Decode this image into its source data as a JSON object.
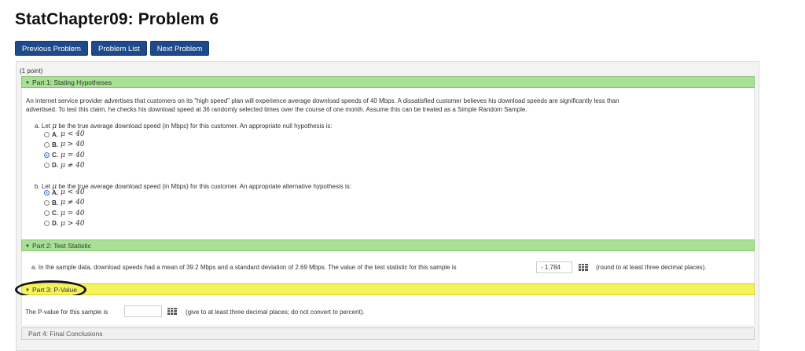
{
  "page_title": "StatChapter09: Problem 6",
  "nav": {
    "previous": "Previous Problem",
    "list": "Problem List",
    "next": "Next Problem"
  },
  "points": "(1 point)",
  "part1": {
    "header": "Part 1: Stating Hypotheses",
    "intro_line1": "An internet service provider advertises that customers on its \"high speed\" plan will experience average download speeds of 40 Mbps. A dissatisfied customer believes his download speeds are significantly less than",
    "intro_line2": "advertised. To test this claim, he checks his download speed at 36 randomly selected times over the course of one month. Assume this can be treated as a Simple Random Sample.",
    "qa": {
      "prompt_start": "a. Let",
      "symbol": "μ",
      "prompt_rest": "be the true average download speed (in Mbps) for this customer. An appropriate null hypothesis is:",
      "options": [
        {
          "label": "A.",
          "expr": "μ < 40",
          "selected": false
        },
        {
          "label": "B.",
          "expr": "μ > 40",
          "selected": false
        },
        {
          "label": "C.",
          "expr": "μ = 40",
          "selected": true
        },
        {
          "label": "D.",
          "expr": "μ ≠ 40",
          "selected": false
        }
      ]
    },
    "qb": {
      "prompt_start": "b. Let",
      "symbol": "μ",
      "prompt_rest": "be the true average download speed (in Mbps) for this customer. An appropriate alternative hypothesis is:",
      "options": [
        {
          "label": "A.",
          "expr": "μ < 40",
          "selected": true
        },
        {
          "label": "B.",
          "expr": "μ ≠ 40",
          "selected": false
        },
        {
          "label": "C.",
          "expr": "μ = 40",
          "selected": false
        },
        {
          "label": "D.",
          "expr": "μ > 40",
          "selected": false
        }
      ]
    }
  },
  "part2": {
    "header": "Part 2: Test Statistic",
    "question": "a. In the sample data, download speeds had a mean of 39.2 Mbps and a standard deviation of 2.69 Mbps. The value of the test statistic for this sample is",
    "answer": "- 1.784",
    "hint": "(round to at least three decimal places)."
  },
  "part3": {
    "header": "Part 3: P-Value",
    "question": "The P-value for this sample is",
    "answer": "",
    "hint": "(give to at least three decimal places; do not convert to percent)."
  },
  "part4": {
    "header": "Part 4: Final Conclusions"
  }
}
